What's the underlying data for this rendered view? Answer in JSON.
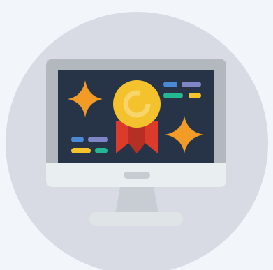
{
  "illustration": {
    "icon_name": "computer-monitor-award-icon",
    "colors": {
      "background": "#f2f5fa",
      "circle": "#d8dbe4",
      "monitor_bezel": "#b3b8bf",
      "monitor_base": "#e9eff0",
      "screen": "#273448",
      "stand": "#c8cdd4",
      "stand_foot": "#dfe5e7",
      "power_button": "#c7ccd2",
      "sparkle": "#f29b26",
      "medal": "#f4c22d",
      "medal_inner": "#f7d56b",
      "ribbon": "#dc3b2c",
      "ribbon_shadow": "#b52f24",
      "line_blue": "#4a89d6",
      "line_purple": "#7f86c5",
      "line_yellow": "#f4c22d",
      "line_green": "#23b793"
    }
  }
}
